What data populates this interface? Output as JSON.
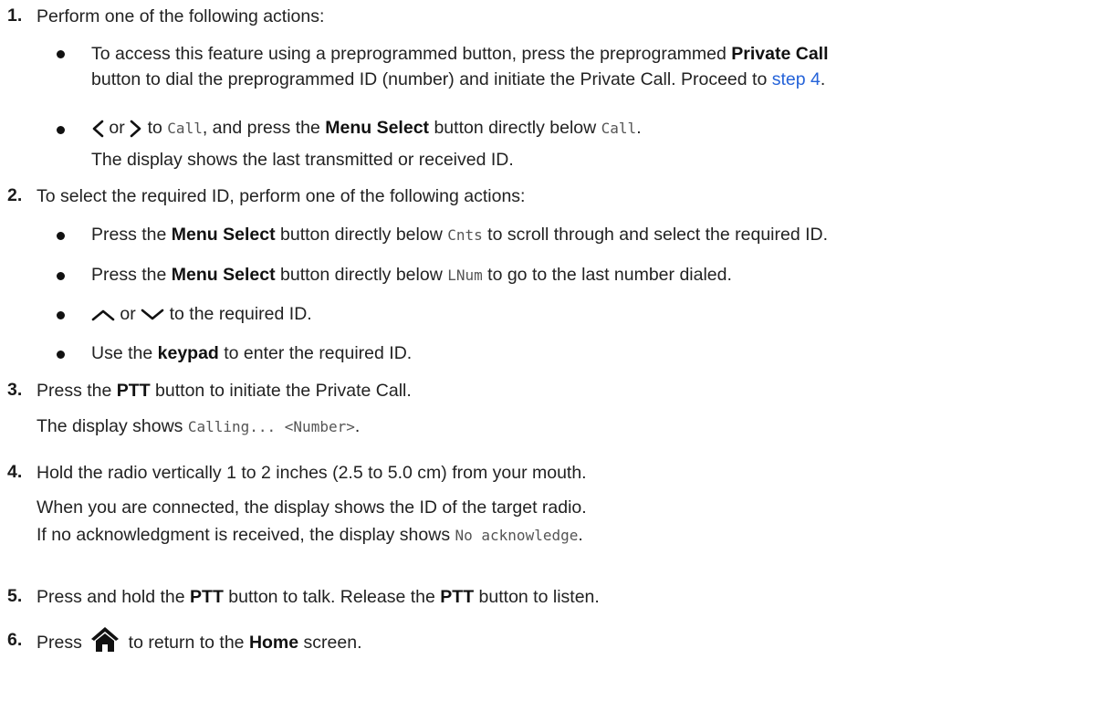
{
  "steps": {
    "s1": {
      "num": "1.",
      "text": "Perform one of the following actions:",
      "b1": {
        "l1_pre": "To access this feature using a preprogrammed button, press the preprogrammed ",
        "l1_bold": "Private Call",
        "l2_pre": "button to dial the preprogrammed ID (number) and initiate the Private Call. Proceed to ",
        "link": "step 4",
        "l2_end": "."
      },
      "b2": {
        "or": "or",
        "to": "to",
        "call1": "Call",
        "mid": ", and press the ",
        "bold": "Menu Select",
        "after": " button directly below ",
        "call2": "Call",
        "end": ".",
        "line2": "The display shows the last transmitted or received ID."
      }
    },
    "s2": {
      "num": "2.",
      "text": "To select the required ID, perform one of the following actions:",
      "b1": {
        "pre": "Press the ",
        "bold": "Menu Select",
        "mid": " button directly below ",
        "code": "Cnts",
        "post": " to scroll through and select the required ID."
      },
      "b2": {
        "pre": "Press the ",
        "bold": "Menu Select",
        "mid": " button directly below ",
        "code": "LNum",
        "post": " to go to the last number dialed."
      },
      "b3": {
        "or": "or",
        "post": "to the required ID."
      },
      "b4": {
        "pre": "Use the ",
        "bold": "keypad",
        "post": " to enter the required ID."
      }
    },
    "s3": {
      "num": "3.",
      "pre": "Press the ",
      "bold": "PTT",
      "post": " button to initiate the Private Call.",
      "line2_pre": "The display shows ",
      "code": "Calling... <Number>",
      "line2_end": "."
    },
    "s4": {
      "num": "4.",
      "text": "Hold the radio vertically 1 to 2 inches (2.5 to 5.0 cm) from your mouth.",
      "line2": "When you are connected, the display shows the ID of the target radio.",
      "line3_pre": "If no acknowledgment is received, the display shows ",
      "code": "No acknowledge",
      "line3_end": "."
    },
    "s5": {
      "num": "5.",
      "pre": "Press and hold the ",
      "bold1": "PTT",
      "mid": " button to talk. Release the ",
      "bold2": "PTT",
      "post": " button to listen."
    },
    "s6": {
      "num": "6.",
      "pre": "Press ",
      "mid": " to return to the ",
      "bold": "Home",
      "post": " screen."
    }
  },
  "icons": [
    "left-arrow-icon",
    "right-arrow-icon",
    "up-arrow-icon",
    "down-arrow-icon",
    "home-icon"
  ]
}
